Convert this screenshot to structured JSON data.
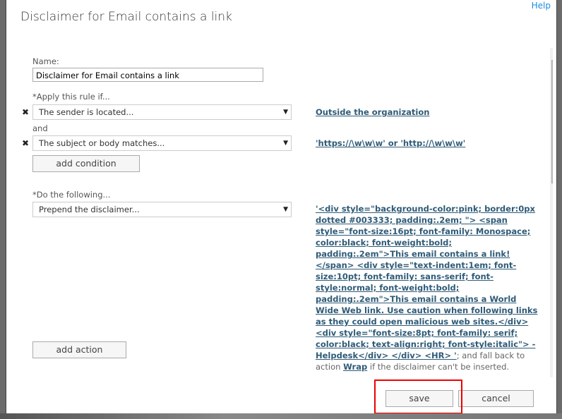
{
  "dialog": {
    "title": "Disclaimer for Email contains a link",
    "help": "Help"
  },
  "form": {
    "name_label": "Name:",
    "name_value": "Disclaimer for Email contains a link",
    "apply_label": "*Apply this rule if...",
    "condition1": "The sender is located...",
    "condition1_value": "Outside the organization",
    "and_label": "and",
    "condition2": "The subject or body matches...",
    "condition2_value": "'https://\\w\\w\\w' or 'http://\\w\\w\\w'",
    "add_condition": "add condition",
    "do_label": "*Do the following...",
    "action": "Prepend the disclaimer...",
    "disclaimer_link": "'<div style=\"background-color:pink; border:0px dotted #003333; padding:.2em; \"> <span style=\"font-size:16pt; font-family: Monospace; color:black; font-weight:bold; padding:.2em\">This email contains a link!</span> <div style=\"text-indent:1em; font-size:10pt; font-family: sans-serif; font-style:normal; font-weight:bold; padding:.2em\">This email contains a World Wide Web link. Use caution when following links as they could open malicious web sites.</div> <div style=\"font-size:8pt; font-family: serif; color:black; text-align:right; font-style:italic\"> -Helpdesk</div> </div> <HR> '",
    "fallback_text": "; and fall back to action ",
    "fallback_action": "Wrap",
    "fallback_suffix": " if the disclaimer can't be inserted.",
    "add_action": "add action"
  },
  "footer": {
    "save": "save",
    "cancel": "cancel"
  }
}
